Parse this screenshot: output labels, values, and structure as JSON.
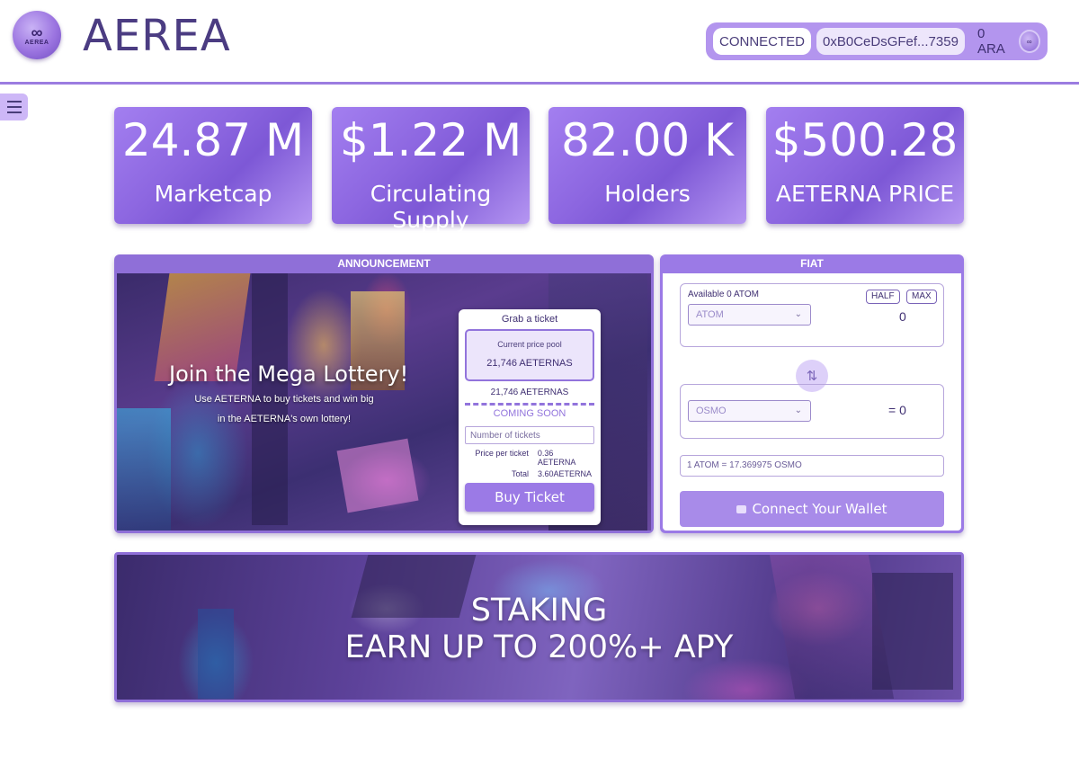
{
  "header": {
    "brand": "AEREA",
    "logo_text": "AEREA",
    "status": "CONNECTED",
    "address": "0xB0CeDsGFef...7359",
    "balance": "0 ARA",
    "avatar_text": "AEREA"
  },
  "stats": [
    {
      "value": "24.87 M",
      "label": "Marketcap"
    },
    {
      "value": "$1.22 M",
      "label": "Circulating Supply"
    },
    {
      "value": "82.00 K",
      "label": "Holders"
    },
    {
      "value": "$500.28",
      "label": "AETERNA PRICE"
    }
  ],
  "announcement": {
    "header": "ANNOUNCEMENT",
    "title": "Join the Mega Lottery!",
    "sub_line1": "Use AETERNA to buy tickets and win big",
    "sub_line2": "in the AETERNA's own lottery!",
    "ticket": {
      "heading": "Grab a ticket",
      "pool_label": "Current price pool",
      "pool_value": "21,746 AETERNAS",
      "pool_line": "21,746 AETERNAS",
      "coming_soon": "COMING SOON",
      "input_placeholder": "Number of tickets",
      "price_label": "Price per ticket",
      "price_value": "0.36 AETERNA",
      "total_label": "Total",
      "total_value": "3.60AETERNA",
      "buy_label": "Buy Ticket"
    }
  },
  "fiat": {
    "header": "FIAT",
    "available": "Available 0 ATOM",
    "half": "HALF",
    "max": "MAX",
    "from_token": "ATOM",
    "from_amount": "0",
    "to_token": "OSMO",
    "to_amount": "= 0",
    "rate": "1 ATOM = 17.369975 OSMO",
    "connect_label": "Connect Your Wallet"
  },
  "staking": {
    "line1": "STAKING",
    "line2": "EARN UP TO 200%+ APY"
  },
  "colors": {
    "accent": "#9b7ae6",
    "brand_text": "#4b3c82",
    "card_gradient_start": "#a37ff0",
    "card_gradient_end": "#7d58d6"
  }
}
